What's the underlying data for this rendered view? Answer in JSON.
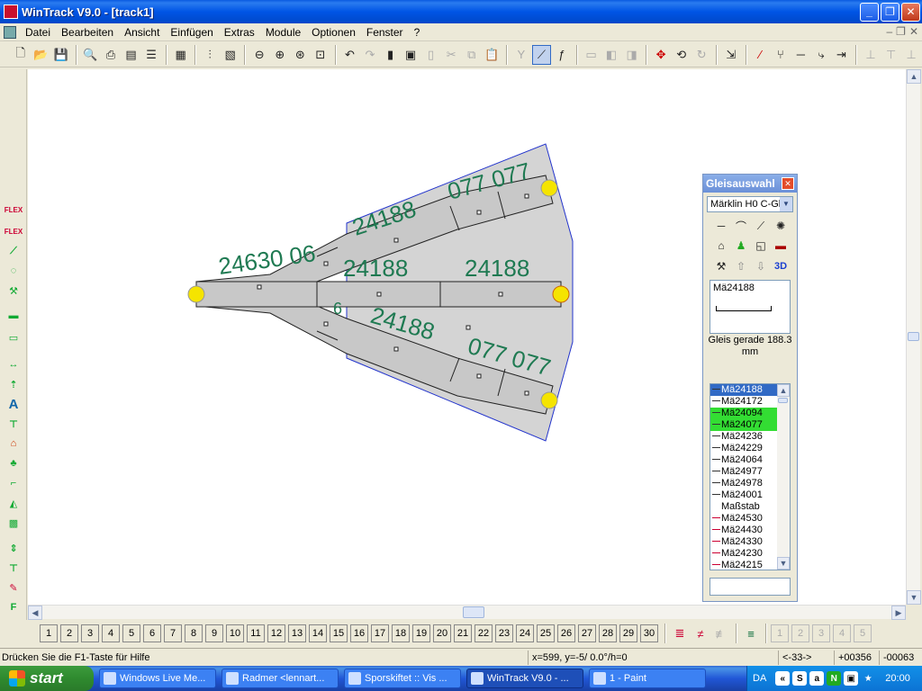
{
  "window": {
    "title": "WinTrack  V9.0 - [track1]"
  },
  "menu": [
    "Datei",
    "Bearbeiten",
    "Ansicht",
    "Einfügen",
    "Extras",
    "Module",
    "Optionen",
    "Fenster",
    "?"
  ],
  "toolbar_icons": [
    "new-icon",
    "open-icon",
    "save-icon",
    "print-preview-icon",
    "print-icon",
    "print-setup-icon",
    "list-icon",
    "library-icon",
    "parts-list-icon",
    "image-icon",
    "zoom-out-icon",
    "zoom-in-icon",
    "zoom-window-icon",
    "zoom-fit-icon",
    "undo-icon",
    "redo-icon",
    "delete-icon",
    "copy-icon",
    "paste-special-icon",
    "cut-icon",
    "copy2-icon",
    "paste-icon",
    "switch-icon",
    "curve-icon",
    "flex-icon"
  ],
  "canvas": {
    "labels": [
      "24630  06",
      "24188",
      "077 077",
      "24188",
      "24188",
      "24188",
      "077  077",
      "6"
    ]
  },
  "panel": {
    "title": "Gleisauswahl",
    "close": "✕",
    "system": "Märklin H0 C-Gl",
    "preview_name": "Mä24188",
    "description": "Gleis gerade 188.3 mm",
    "track_list": [
      {
        "name": "Mä24188",
        "state": "selected"
      },
      {
        "name": "Mä24172",
        "state": ""
      },
      {
        "name": "Mä24094",
        "state": "green"
      },
      {
        "name": "Mä24077",
        "state": "green"
      },
      {
        "name": "Mä24236",
        "state": ""
      },
      {
        "name": "Mä24229",
        "state": ""
      },
      {
        "name": "Mä24064",
        "state": ""
      },
      {
        "name": "Mä24977",
        "state": ""
      },
      {
        "name": "Mä24978",
        "state": ""
      },
      {
        "name": "Mä24001",
        "state": ""
      },
      {
        "name": "Maßstab",
        "state": "plain"
      },
      {
        "name": "Mä24530",
        "state": "red"
      },
      {
        "name": "Mä24430",
        "state": "red"
      },
      {
        "name": "Mä24330",
        "state": "red"
      },
      {
        "name": "Mä24230",
        "state": "red"
      },
      {
        "name": "Mä24215",
        "state": "red"
      }
    ]
  },
  "layers": [
    "1",
    "2",
    "3",
    "4",
    "5",
    "6",
    "7",
    "8",
    "9",
    "10",
    "11",
    "12",
    "13",
    "14",
    "15",
    "16",
    "17",
    "18",
    "19",
    "20",
    "21",
    "22",
    "23",
    "24",
    "25",
    "26",
    "27",
    "28",
    "29",
    "30"
  ],
  "layers_extra": [
    "1",
    "2",
    "3",
    "4",
    "5"
  ],
  "status": {
    "help": "Drücken Sie die  F1-Taste für Hilfe",
    "coords": "x=599, y=-5/ 0.0°/h=0",
    "count": "<-33->",
    "x": "+00356",
    "y": "-00063"
  },
  "taskbar": {
    "start": "start",
    "tasks": [
      "Windows Live Me...",
      "Radmer <lennart...",
      "Sporskiftet :: Vis ...",
      "WinTrack  V9.0 - ...",
      "1 - Paint"
    ],
    "lang": "DA",
    "clock": "20:00"
  },
  "left_tools": [
    "FLEX",
    "FLEX"
  ]
}
